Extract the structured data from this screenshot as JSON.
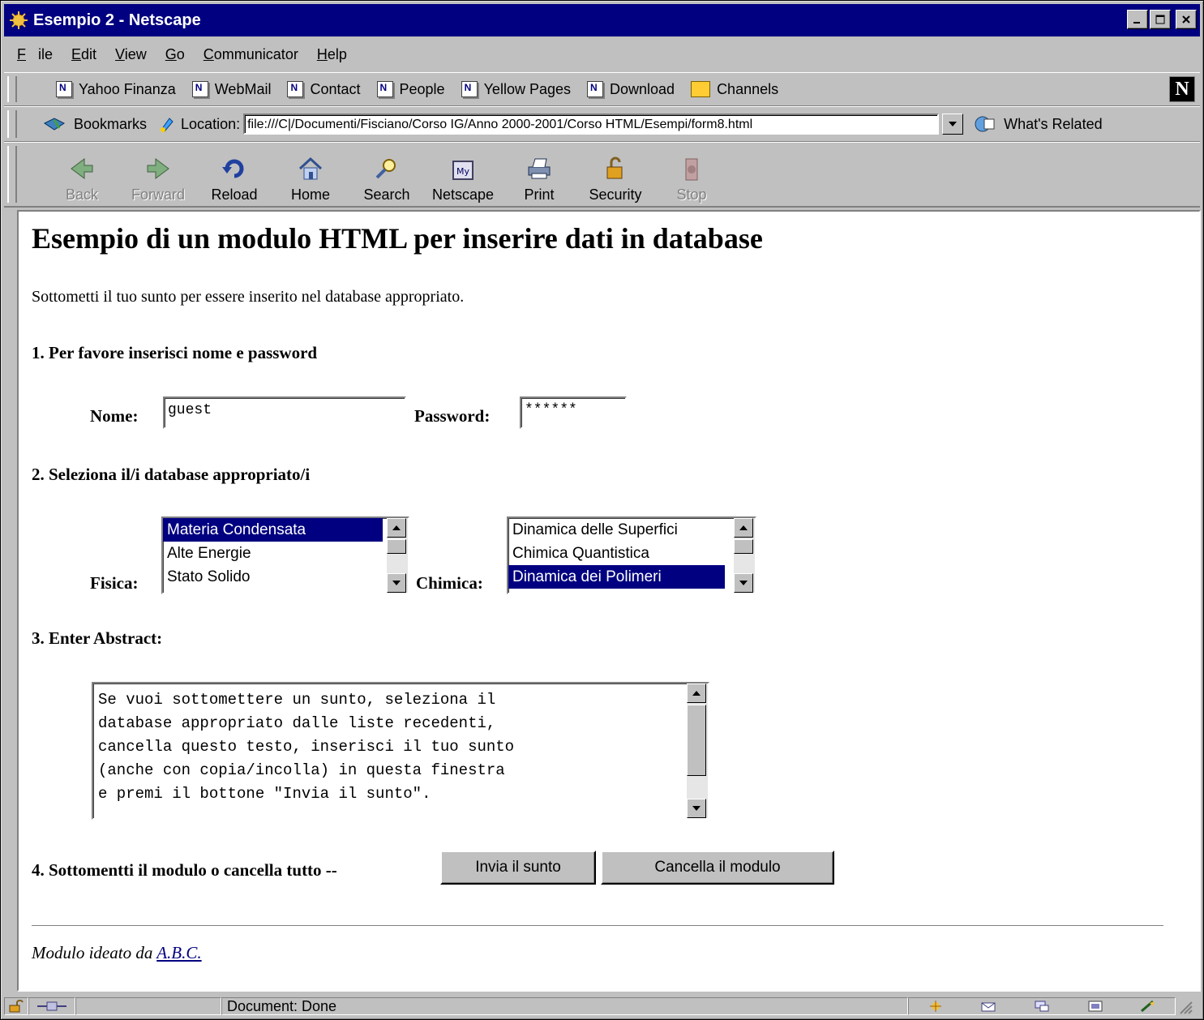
{
  "window": {
    "title": "Esempio 2 - Netscape"
  },
  "menu": [
    {
      "label": "File",
      "key": "F",
      "rest": "ile"
    },
    {
      "label": "Edit",
      "key": "E",
      "rest": "dit"
    },
    {
      "label": "View",
      "key": "V",
      "rest": "iew"
    },
    {
      "label": "Go",
      "key": "G",
      "rest": "o"
    },
    {
      "label": "Communicator",
      "key": "C",
      "rest": "ommunicator"
    },
    {
      "label": "Help",
      "key": "H",
      "rest": "elp"
    }
  ],
  "personal_toolbar": [
    "Yahoo Finanza",
    "WebMail",
    "Contact",
    "People",
    "Yellow Pages",
    "Download",
    "Channels"
  ],
  "location_bar": {
    "bookmarks_label": "Bookmarks",
    "location_label": "Location:",
    "url": "file:///C|/Documenti/Fisciano/Corso IG/Anno 2000-2001/Corso HTML/Esempi/form8.html",
    "whats_related": "What's Related"
  },
  "nav_toolbar": {
    "back": "Back",
    "forward": "Forward",
    "reload": "Reload",
    "home": "Home",
    "search": "Search",
    "netscape": "Netscape",
    "print": "Print",
    "security": "Security",
    "stop": "Stop"
  },
  "page": {
    "heading": "Esempio di un modulo HTML per inserire dati in database",
    "intro": "Sottometti il tuo sunto per essere inserito nel database appropriato.",
    "section1": "1. Per favore inserisci nome e password",
    "nome_label": "Nome:",
    "nome_value": "guest",
    "password_label": "Password:",
    "password_value": "******",
    "section2": "2. Seleziona il/i database appropriato/i",
    "fisica_label": "Fisica:",
    "fisica_options": [
      "Materia Condensata",
      "Alte Energie",
      "Stato Solido"
    ],
    "fisica_selected": 0,
    "chimica_label": "Chimica:",
    "chimica_options": [
      "Dinamica delle Superfici",
      "Chimica Quantistica",
      "Dinamica dei Polimeri"
    ],
    "chimica_selected": 2,
    "section3": "3. Enter Abstract:",
    "abstract_text": "Se vuoi sottomettere un sunto, seleziona il\ndatabase appropriato dalle liste recedenti,\ncancella questo testo, inserisci il tuo sunto\n(anche con copia/incolla) in questa finestra\ne premi il bottone \"Invia il sunto\".",
    "section4": "4. Sottomentti il modulo o cancella tutto --",
    "submit_label": "Invia il sunto",
    "reset_label": "Cancella il modulo",
    "footer_prefix": "Modulo ideato da",
    "footer_link": "A.B.C."
  },
  "status": {
    "text": "Document: Done"
  }
}
